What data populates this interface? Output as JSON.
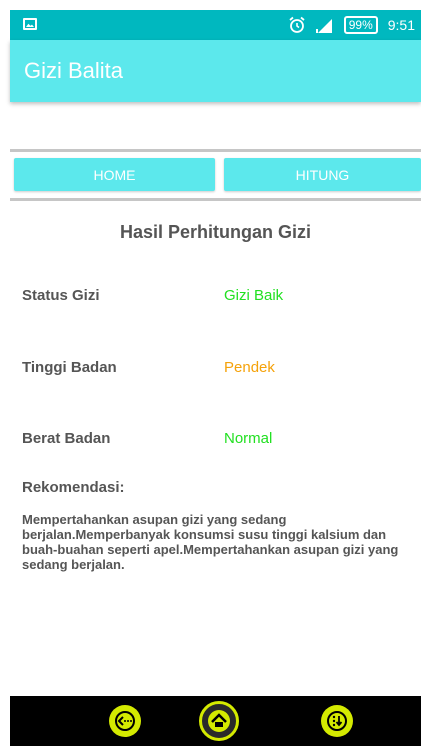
{
  "status_bar": {
    "battery": "99%",
    "time": "9:51",
    "icons": [
      "image-icon",
      "alarm-icon",
      "signal-icon"
    ]
  },
  "app_bar": {
    "title": "Gizi Balita"
  },
  "tabs": [
    {
      "label": "HOME"
    },
    {
      "label": "HITUNG"
    }
  ],
  "result": {
    "title": "Hasil Perhitungan Gizi",
    "rows": [
      {
        "label": "Status Gizi",
        "value": "Gizi Baik",
        "color": "#22e022"
      },
      {
        "label": "Tinggi Badan",
        "value": "Pendek",
        "color": "#f5a20a"
      },
      {
        "label": "Berat Badan",
        "value": "Normal",
        "color": "#22e022"
      }
    ],
    "recommendation_label": "Rekomendasi:",
    "recommendation_text": "Mempertahankan asupan gizi yang sedang berjalan.Memperbanyak konsumsi susu tinggi kalsium dan buah-buahan seperti apel.Mempertahankan asupan gizi yang sedang berjalan."
  },
  "nav_bar": {
    "icons": [
      "back-icon",
      "home-icon",
      "menu-icon"
    ]
  },
  "colors": {
    "status_bar": "#00b8bf",
    "app_bar": "#5ce8ec",
    "accent_green": "#22e022",
    "accent_orange": "#f5a20a",
    "nav_accent": "#d4ea00"
  }
}
